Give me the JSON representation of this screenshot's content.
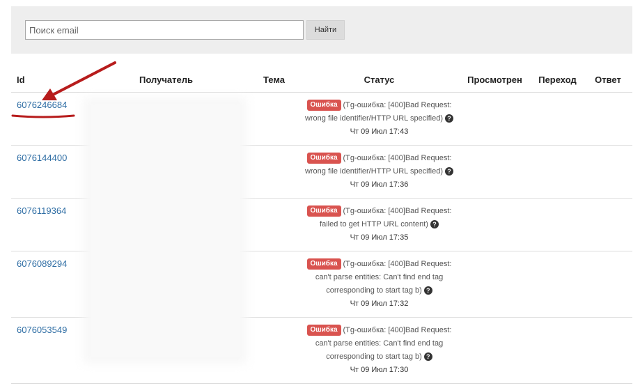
{
  "search": {
    "placeholder": "Поиск email",
    "button_label": "Найти"
  },
  "table": {
    "headers": {
      "id": "Id",
      "recipient": "Получатель",
      "subject": "Тема",
      "status": "Статус",
      "viewed": "Просмотрен",
      "clicked": "Переход",
      "reply": "Ответ"
    },
    "rows": [
      {
        "id": "6076246684",
        "badge": "Ошибка",
        "message": "(Tg-ошибка: [400]Bad Request: wrong file identifier/HTTP URL specified)",
        "date": "Чт 09 Июл 17:43"
      },
      {
        "id": "6076144400",
        "badge": "Ошибка",
        "message": "(Tg-ошибка: [400]Bad Request: wrong file identifier/HTTP URL specified)",
        "date": "Чт 09 Июл 17:36"
      },
      {
        "id": "6076119364",
        "badge": "Ошибка",
        "message": "(Tg-ошибка: [400]Bad Request: failed to get HTTP URL content)",
        "date": "Чт 09 Июл 17:35"
      },
      {
        "id": "6076089294",
        "badge": "Ошибка",
        "message": "(Tg-ошибка: [400]Bad Request: can't parse entities: Can't find end tag corresponding to start tag b)",
        "date": "Чт 09 Июл 17:32"
      },
      {
        "id": "6076053549",
        "badge": "Ошибка",
        "message": "(Tg-ошибка: [400]Bad Request: can't parse entities: Can't find end tag corresponding to start tag b)",
        "date": "Чт 09 Июл 17:30"
      }
    ]
  },
  "colors": {
    "error_badge": "#d9534f",
    "link": "#2e6da4",
    "annotation_arrow": "#b71c1c"
  },
  "icons": {
    "help": "question-circle-icon",
    "annotation": "red-arrow-annotation"
  }
}
